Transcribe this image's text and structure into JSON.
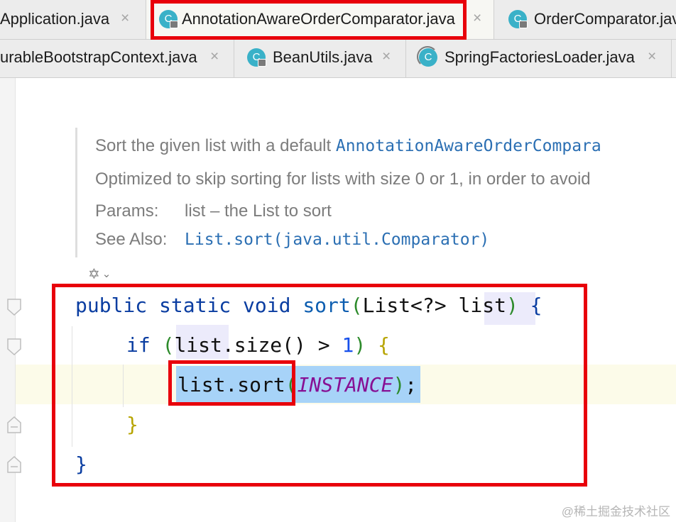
{
  "tabs_row1": [
    {
      "label": "Application.java",
      "close": "×",
      "icon": "none",
      "active": false
    },
    {
      "label": "AnnotationAwareOrderComparator.java",
      "close": "×",
      "icon": "java-class-locked-icon",
      "active": true
    },
    {
      "label": "OrderComparator.java",
      "close": "",
      "icon": "java-class-locked-icon",
      "active": false
    }
  ],
  "tabs_row2": [
    {
      "label": "urableBootstrapContext.java",
      "close": "×",
      "icon": "none"
    },
    {
      "label": "BeanUtils.java",
      "close": "×",
      "icon": "java-class-locked-icon"
    },
    {
      "label": "SpringFactoriesLoader.java",
      "close": "×",
      "icon": "java-class-locked-icon"
    }
  ],
  "icon_letter": "C",
  "doc": {
    "line1_text": "Sort the given list with a default ",
    "line1_link": "AnnotationAwareOrderCompara",
    "line2": "Optimized to skip sorting for lists with size 0 or 1, in order to avoid",
    "params_label": "Params:",
    "params_value": "list – the List to sort",
    "see_also_label": "See Also:",
    "see_also_link": "List.sort(java.util.Comparator)"
  },
  "code": {
    "l1": {
      "kw1": "public",
      "kw2": "static",
      "kw3": "void",
      "method": "sort",
      "open": "(",
      "type": "List<?>",
      "param": "list",
      "close": ")",
      "brace": "{"
    },
    "l2": {
      "kw": "if",
      "open": "(",
      "expr": "list.size()",
      "op": ">",
      "num": "1",
      "close": ")",
      "brace": "{"
    },
    "l3": {
      "call": "list.sort",
      "open": "(",
      "arg": "INSTANCE",
      "close": ")",
      "semi": ";"
    },
    "l4": {
      "brace": "}"
    },
    "l5": {
      "brace": "}"
    }
  },
  "colors": {
    "annotation_red": "#e8000b",
    "keyword": "#0a3da1",
    "constant": "#871094",
    "selection": "#a7d3f8",
    "class_icon": "#3ab1c8"
  },
  "watermark": "@稀土掘金技术社区"
}
